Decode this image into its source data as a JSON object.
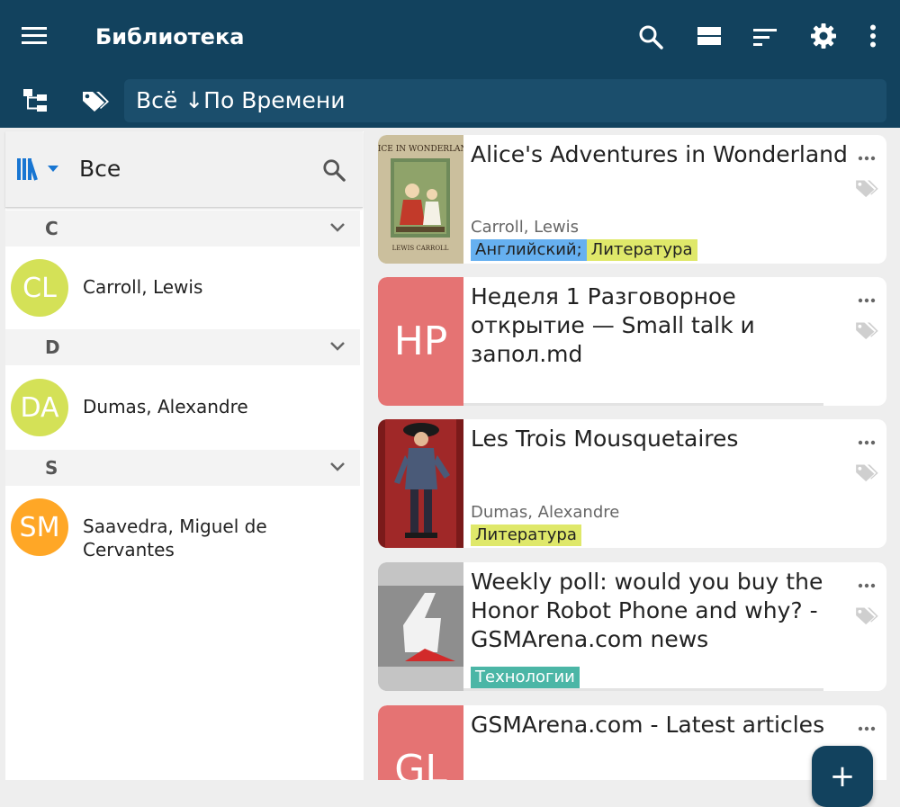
{
  "app": {
    "title": "Библиотека"
  },
  "filter": {
    "label": "Всё ↓По Времени"
  },
  "left_panel": {
    "search_label": "Все",
    "sections": [
      {
        "letter": "C",
        "authors": [
          {
            "initials": "CL",
            "name": "Carroll, Lewis",
            "color": "#d4e157"
          }
        ]
      },
      {
        "letter": "D",
        "authors": [
          {
            "initials": "DA",
            "name": "Dumas, Alexandre",
            "color": "#d4e157"
          }
        ]
      },
      {
        "letter": "S",
        "authors": [
          {
            "initials": "SM",
            "name": "Saavedra, Miguel de Cervantes",
            "color": "#ffa726"
          }
        ]
      }
    ]
  },
  "books": [
    {
      "title": "Alice's Adventures in Wonderland",
      "author": "Carroll, Lewis",
      "tags": [
        {
          "label": "Английский;",
          "color": "blue"
        },
        {
          "label": "Литература",
          "color": "yellow"
        }
      ],
      "cover_text_top": "ALICE IN WONDERLAND",
      "cover_text_bottom": "LEWIS CARROLL"
    },
    {
      "title": "Неделя 1 Разговорное открытие — Small talk и запол.md",
      "initials": "HP"
    },
    {
      "title": "Les Trois Mousquetaires",
      "author": "Dumas, Alexandre",
      "tags": [
        {
          "label": "Литература",
          "color": "yellow"
        }
      ]
    },
    {
      "title": "Weekly poll: would you buy the Honor Robot Phone and why? - GSMArena.com news",
      "tags": [
        {
          "label": "Технологии",
          "color": "teal"
        }
      ]
    },
    {
      "title": "GSMArena.com - Latest articles",
      "initials": "GL"
    }
  ],
  "fab": {
    "label": "+"
  },
  "colors": {
    "appbar": "#12425e",
    "accent": "#1976d2"
  }
}
